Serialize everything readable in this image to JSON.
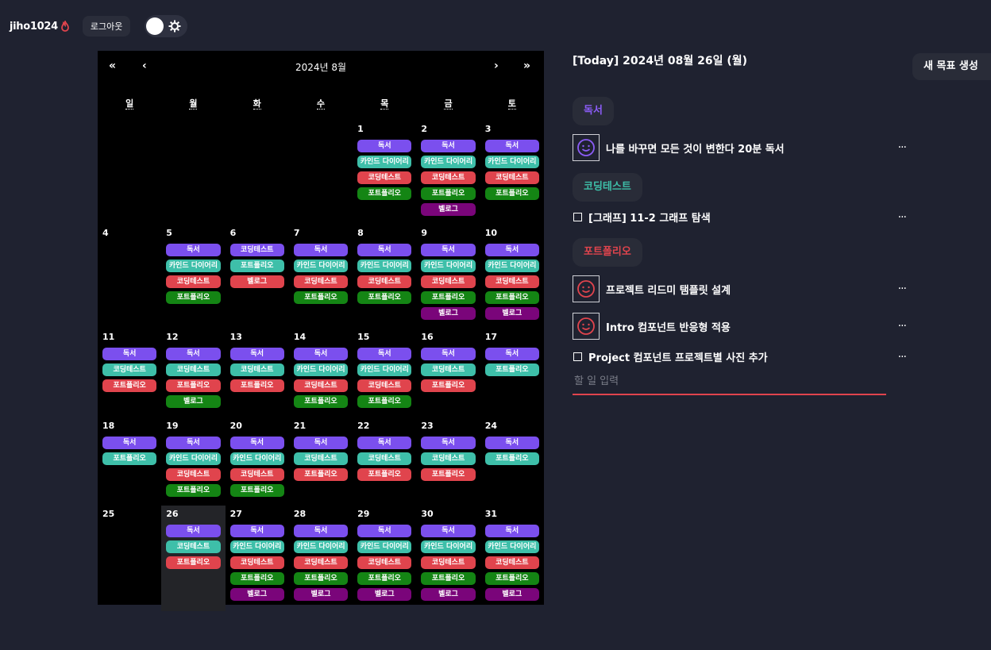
{
  "header": {
    "username": "jiho1024",
    "logout_label": "로그아웃",
    "icons": [
      "flame-icon",
      "gear-icon"
    ]
  },
  "calendar": {
    "title": "2024년 8월",
    "nav": {
      "prev_year": "«",
      "prev_month": "‹",
      "next_month": "›",
      "next_year": "»"
    },
    "weekdays": [
      "일",
      "월",
      "화",
      "수",
      "목",
      "금",
      "토"
    ],
    "today": 26,
    "weeks": [
      [
        {
          "day": "",
          "tags": []
        },
        {
          "day": "",
          "tags": []
        },
        {
          "day": "",
          "tags": []
        },
        {
          "day": "",
          "tags": []
        },
        {
          "day": "1",
          "tags": [
            [
              "독서",
              "c1"
            ],
            [
              "카인드 다이어리",
              "c2"
            ],
            [
              "코딩테스트",
              "c3"
            ],
            [
              "포트폴리오",
              "c4"
            ]
          ]
        },
        {
          "day": "2",
          "tags": [
            [
              "독서",
              "c1"
            ],
            [
              "카인드 다이어리",
              "c2"
            ],
            [
              "코딩테스트",
              "c3"
            ],
            [
              "포트폴리오",
              "c4"
            ],
            [
              "벨로그",
              "c5"
            ]
          ]
        },
        {
          "day": "3",
          "tags": [
            [
              "독서",
              "c1"
            ],
            [
              "카인드 다이어리",
              "c2"
            ],
            [
              "코딩테스트",
              "c3"
            ],
            [
              "포트폴리오",
              "c4"
            ]
          ]
        }
      ],
      [
        {
          "day": "4",
          "tags": []
        },
        {
          "day": "5",
          "tags": [
            [
              "독서",
              "c1"
            ],
            [
              "카인드 다이어리",
              "c2"
            ],
            [
              "코딩테스트",
              "c3"
            ],
            [
              "포트폴리오",
              "c4"
            ]
          ]
        },
        {
          "day": "6",
          "tags": [
            [
              "코딩테스트",
              "c1"
            ],
            [
              "포트폴리오",
              "c2"
            ],
            [
              "벨로그",
              "c3"
            ]
          ]
        },
        {
          "day": "7",
          "tags": [
            [
              "독서",
              "c1"
            ],
            [
              "카인드 다이어리",
              "c2"
            ],
            [
              "코딩테스트",
              "c3"
            ],
            [
              "포트폴리오",
              "c4"
            ]
          ]
        },
        {
          "day": "8",
          "tags": [
            [
              "독서",
              "c1"
            ],
            [
              "카인드 다이어리",
              "c2"
            ],
            [
              "코딩테스트",
              "c3"
            ],
            [
              "포트폴리오",
              "c4"
            ]
          ]
        },
        {
          "day": "9",
          "tags": [
            [
              "독서",
              "c1"
            ],
            [
              "카인드 다이어리",
              "c2"
            ],
            [
              "코딩테스트",
              "c3"
            ],
            [
              "포트폴리오",
              "c4"
            ],
            [
              "벨로그",
              "c5"
            ]
          ]
        },
        {
          "day": "10",
          "tags": [
            [
              "독서",
              "c1"
            ],
            [
              "카인드 다이어리",
              "c2"
            ],
            [
              "코딩테스트",
              "c3"
            ],
            [
              "포트폴리오",
              "c4"
            ],
            [
              "벨로그",
              "c5"
            ]
          ]
        }
      ],
      [
        {
          "day": "11",
          "tags": [
            [
              "독서",
              "c1"
            ],
            [
              "코딩테스트",
              "c2"
            ],
            [
              "포트폴리오",
              "c3"
            ]
          ]
        },
        {
          "day": "12",
          "tags": [
            [
              "독서",
              "c1"
            ],
            [
              "코딩테스트",
              "c2"
            ],
            [
              "포트폴리오",
              "c3"
            ],
            [
              "벨로그",
              "c4"
            ]
          ]
        },
        {
          "day": "13",
          "tags": [
            [
              "독서",
              "c1"
            ],
            [
              "코딩테스트",
              "c2"
            ],
            [
              "포트폴리오",
              "c3"
            ]
          ]
        },
        {
          "day": "14",
          "tags": [
            [
              "독서",
              "c1"
            ],
            [
              "카인드 다이어리",
              "c2"
            ],
            [
              "코딩테스트",
              "c3"
            ],
            [
              "포트폴리오",
              "c4"
            ]
          ]
        },
        {
          "day": "15",
          "tags": [
            [
              "독서",
              "c1"
            ],
            [
              "카인드 다이어리",
              "c2"
            ],
            [
              "코딩테스트",
              "c3"
            ],
            [
              "포트폴리오",
              "c4"
            ]
          ]
        },
        {
          "day": "16",
          "tags": [
            [
              "독서",
              "c1"
            ],
            [
              "코딩테스트",
              "c2"
            ],
            [
              "포트폴리오",
              "c3"
            ]
          ]
        },
        {
          "day": "17",
          "tags": [
            [
              "독서",
              "c1"
            ],
            [
              "포트폴리오",
              "c2"
            ]
          ]
        }
      ],
      [
        {
          "day": "18",
          "tags": [
            [
              "독서",
              "c1"
            ],
            [
              "포트폴리오",
              "c2"
            ]
          ]
        },
        {
          "day": "19",
          "tags": [
            [
              "독서",
              "c1"
            ],
            [
              "카인드 다이어리",
              "c2"
            ],
            [
              "코딩테스트",
              "c3"
            ],
            [
              "포트폴리오",
              "c4"
            ]
          ]
        },
        {
          "day": "20",
          "tags": [
            [
              "독서",
              "c1"
            ],
            [
              "카인드 다이어리",
              "c2"
            ],
            [
              "코딩테스트",
              "c3"
            ],
            [
              "포트폴리오",
              "c4"
            ]
          ]
        },
        {
          "day": "21",
          "tags": [
            [
              "독서",
              "c1"
            ],
            [
              "코딩테스트",
              "c2"
            ],
            [
              "포트폴리오",
              "c3"
            ]
          ]
        },
        {
          "day": "22",
          "tags": [
            [
              "독서",
              "c1"
            ],
            [
              "코딩테스트",
              "c2"
            ],
            [
              "포트폴리오",
              "c3"
            ]
          ]
        },
        {
          "day": "23",
          "tags": [
            [
              "독서",
              "c1"
            ],
            [
              "코딩테스트",
              "c2"
            ],
            [
              "포트폴리오",
              "c3"
            ]
          ]
        },
        {
          "day": "24",
          "tags": [
            [
              "독서",
              "c1"
            ],
            [
              "포트폴리오",
              "c2"
            ]
          ]
        }
      ],
      [
        {
          "day": "25",
          "tags": []
        },
        {
          "day": "26",
          "tags": [
            [
              "독서",
              "c1"
            ],
            [
              "코딩테스트",
              "c2"
            ],
            [
              "포트폴리오",
              "c3"
            ]
          ]
        },
        {
          "day": "27",
          "tags": [
            [
              "독서",
              "c1"
            ],
            [
              "카인드 다이어리",
              "c2"
            ],
            [
              "코딩테스트",
              "c3"
            ],
            [
              "포트폴리오",
              "c4"
            ],
            [
              "벨로그",
              "c5"
            ]
          ]
        },
        {
          "day": "28",
          "tags": [
            [
              "독서",
              "c1"
            ],
            [
              "카인드 다이어리",
              "c2"
            ],
            [
              "코딩테스트",
              "c3"
            ],
            [
              "포트폴리오",
              "c4"
            ],
            [
              "벨로그",
              "c5"
            ]
          ]
        },
        {
          "day": "29",
          "tags": [
            [
              "독서",
              "c1"
            ],
            [
              "카인드 다이어리",
              "c2"
            ],
            [
              "코딩테스트",
              "c3"
            ],
            [
              "포트폴리오",
              "c4"
            ],
            [
              "벨로그",
              "c5"
            ]
          ]
        },
        {
          "day": "30",
          "tags": [
            [
              "독서",
              "c1"
            ],
            [
              "카인드 다이어리",
              "c2"
            ],
            [
              "코딩테스트",
              "c3"
            ],
            [
              "포트폴리오",
              "c4"
            ],
            [
              "벨로그",
              "c5"
            ]
          ]
        },
        {
          "day": "31",
          "tags": [
            [
              "독서",
              "c1"
            ],
            [
              "카인드 다이어리",
              "c2"
            ],
            [
              "코딩테스트",
              "c3"
            ],
            [
              "포트폴리오",
              "c4"
            ],
            [
              "벨로그",
              "c5"
            ]
          ]
        }
      ]
    ]
  },
  "today_panel": {
    "title": "[Today] 2024년 08월 26일 (월)",
    "new_goal_label": "새 목표 생성",
    "goals": [
      {
        "name": "독서",
        "color": "#8b5cf6"
      },
      {
        "name": "코딩테스트",
        "color": "#3ebfa9"
      },
      {
        "name": "포트폴리오",
        "color": "#e0444d"
      }
    ],
    "todos": [
      {
        "text": "나를 바꾸면 모든 것이 변한다 20분 독서",
        "done": true,
        "goal": 0
      },
      {
        "text": "[그래프] 11-2 그래프 탐색",
        "done": false,
        "goal": 1
      },
      {
        "text": "프로젝트 리드미 탬플릿 설계",
        "done": true,
        "goal": 2
      },
      {
        "text": "Intro 컴포넌트 반응형 적용",
        "done": true,
        "goal": 2
      },
      {
        "text": "Project 컴포넌트 프로젝트별 사진 추가",
        "done": false,
        "goal": 2
      }
    ],
    "more_label": "···",
    "input_placeholder": "할 일 입력"
  }
}
